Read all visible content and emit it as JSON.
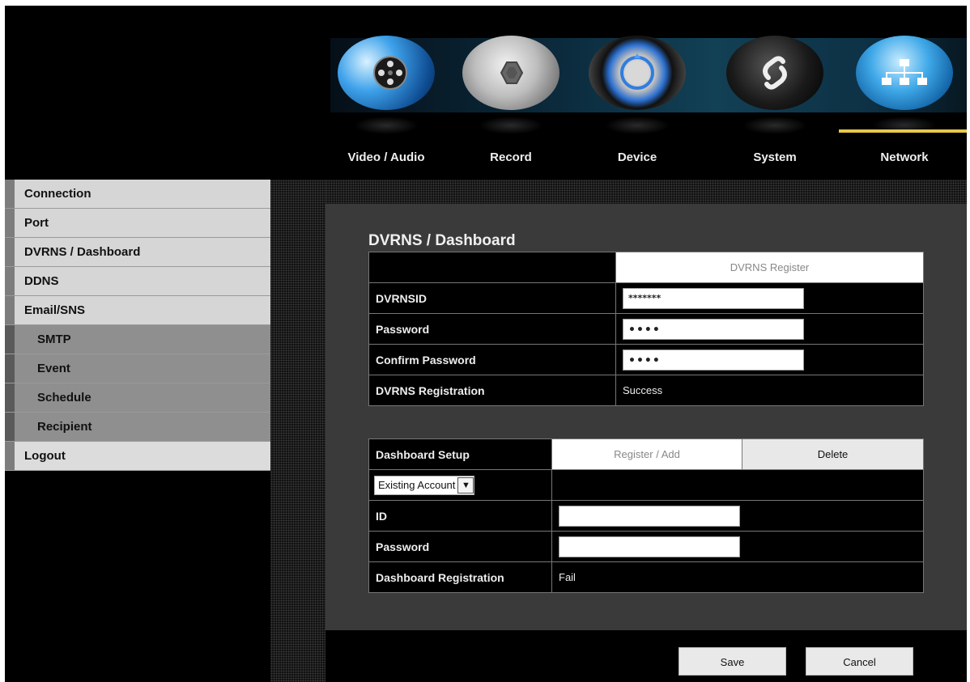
{
  "tabs": [
    {
      "label": "Video / Audio",
      "icon": "film-reel-icon"
    },
    {
      "label": "Record",
      "icon": "camera-shutter-icon"
    },
    {
      "label": "Device",
      "icon": "knob-dial-icon"
    },
    {
      "label": "System",
      "icon": "link-gear-icon"
    },
    {
      "label": "Network",
      "icon": "network-tree-icon"
    }
  ],
  "active_tab": "Network",
  "sidebar": {
    "items": [
      {
        "label": "Connection"
      },
      {
        "label": "Port"
      },
      {
        "label": "DVRNS / Dashboard"
      },
      {
        "label": "DDNS"
      },
      {
        "label": "Email/SNS"
      },
      {
        "label": "SMTP"
      },
      {
        "label": "Event"
      },
      {
        "label": "Schedule"
      },
      {
        "label": "Recipient"
      },
      {
        "label": "Logout"
      }
    ]
  },
  "panel": {
    "title": "DVRNS / Dashboard",
    "dvrns": {
      "register_button": "DVRNS Register",
      "id_label": "DVRNSID",
      "id_value": "*******",
      "password_label": "Password",
      "password_value": "••••",
      "confirm_label": "Confirm Password",
      "confirm_value": "••••",
      "registration_label": "DVRNS Registration",
      "registration_status": "Success"
    },
    "dashboard": {
      "setup_label": "Dashboard Setup",
      "register_button": "Register / Add",
      "delete_button": "Delete",
      "account_select": "Existing Account",
      "id_label": "ID",
      "id_value": "",
      "password_label": "Password",
      "password_value": "",
      "registration_label": "Dashboard Registration",
      "registration_status": "Fail"
    }
  },
  "footer": {
    "save_label": "Save",
    "cancel_label": "Cancel"
  },
  "colors": {
    "accent_underline": "#e8c84a",
    "panel_bg": "#3a3a3a",
    "sidebar_bg": "#d6d6d6",
    "sidebar_sub_bg": "#8f8f8f"
  }
}
